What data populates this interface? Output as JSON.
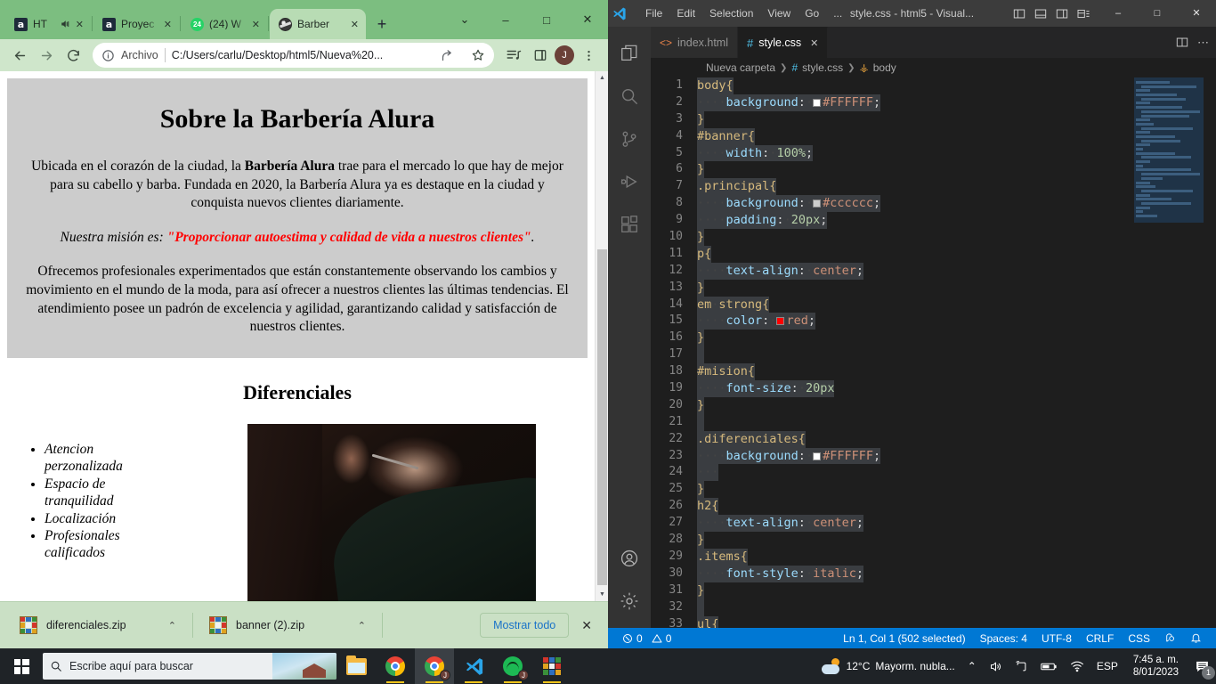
{
  "browser": {
    "tabs": [
      {
        "title": "HT",
        "favicon": "alura-icon",
        "muted": true,
        "active": false
      },
      {
        "title": "Proyec",
        "favicon": "alura-icon",
        "muted": false,
        "active": false
      },
      {
        "title": "(24) W",
        "favicon": "whatsapp-icon",
        "badge": "24",
        "muted": false,
        "active": false
      },
      {
        "title": "Barber",
        "favicon": "globe-icon",
        "muted": false,
        "active": true
      }
    ],
    "new_tab_label": "+",
    "window_controls": {
      "list": "⌄",
      "minimize": "–",
      "maximize": "□",
      "close": "✕"
    },
    "toolbar": {
      "back": "←",
      "forward": "→",
      "reload": "⟳",
      "site_info_icon": "info-icon",
      "omnibox_label": "Archivo",
      "omnibox_url": "C:/Users/carlu/Desktop/html5/Nueva%20...",
      "share_icon": "share-icon",
      "bookmark_icon": "star-icon",
      "reading_list_icon": "reading-list-icon",
      "side_panel_icon": "side-panel-icon",
      "profile_initial": "J",
      "menu_icon": "kebab-menu-icon"
    },
    "downloads": {
      "items": [
        {
          "name": "diferenciales.zip",
          "icon": "winrar-icon",
          "caret": "⌃"
        },
        {
          "name": "banner (2).zip",
          "icon": "winrar-icon",
          "caret": "⌃"
        }
      ],
      "show_all_label": "Mostrar todo",
      "close_label": "✕"
    }
  },
  "webpage": {
    "h1": "Sobre la Barbería Alura",
    "p1_part1": "Ubicada en el corazón de la ciudad, la ",
    "p1_strong": "Barbería Alura",
    "p1_part2": " trae para el mercado lo que hay de mejor para su cabello y barba. Fundada en 2020, la Barbería Alura ya es destaque en la ciudad y conquista nuevos clientes diariamente.",
    "mision_prefix": "Nuestra misión es: ",
    "mision_quote": "\"Proporcionar autoestima y calidad de vida a nuestros clientes\"",
    "mision_suffix": ".",
    "p3": "Ofrecemos profesionales experimentados que están constantemente observando los cambios y movimiento en el mundo de la moda, para así ofrecer a nuestros clientes las últimas tendencias. El atendimiento posee un padrón de excelencia y agilidad, garantizando calidad y satisfacción de nuestros clientes.",
    "h2": "Diferenciales",
    "items": [
      "Atencion perzonalizada",
      "Espacio de tranquilidad",
      "Localización",
      "Profesionales calificados"
    ],
    "image_alt": "barber-trimming-beard-photo"
  },
  "vscode": {
    "title": "style.css - html5 - Visual...",
    "menus": [
      "File",
      "Edit",
      "Selection",
      "View",
      "Go",
      "..."
    ],
    "layout_icons": [
      "toggle-primary-sidebar-icon",
      "toggle-panel-icon",
      "toggle-secondary-sidebar-icon",
      "customize-layout-icon"
    ],
    "window_controls": {
      "minimize": "–",
      "maximize": "□",
      "close": "✕"
    },
    "activity_bar": [
      "explorer-icon",
      "search-icon",
      "source-control-icon",
      "run-and-debug-icon",
      "extensions-icon",
      "account-icon",
      "settings-gear-icon"
    ],
    "tabs": [
      {
        "label": "index.html",
        "icon": "html-file-icon",
        "active": false
      },
      {
        "label": "style.css",
        "icon": "css-file-icon",
        "active": true,
        "close": "✕"
      }
    ],
    "editor_actions": [
      "split-editor-icon",
      "more-actions-icon"
    ],
    "breadcrumb": [
      "Nueva carpeta",
      "style.css",
      "body"
    ],
    "code_lines": [
      {
        "n": 1,
        "tokens": [
          {
            "t": "sel",
            "v": "body"
          },
          {
            "t": "brace",
            "v": "{"
          }
        ]
      },
      {
        "n": 2,
        "tokens": [
          {
            "t": "ws",
            "v": "····"
          },
          {
            "t": "prop",
            "v": "background"
          },
          {
            "t": "punc",
            "v": ":"
          },
          {
            "t": "ws",
            "v": "·"
          },
          {
            "t": "swatch",
            "v": "#FFFFFF"
          },
          {
            "t": "val",
            "v": "#FFFFFF"
          },
          {
            "t": "punc",
            "v": ";"
          }
        ]
      },
      {
        "n": 3,
        "tokens": [
          {
            "t": "brace",
            "v": "}"
          }
        ]
      },
      {
        "n": 4,
        "tokens": [
          {
            "t": "sel",
            "v": "#banner"
          },
          {
            "t": "brace",
            "v": "{"
          }
        ]
      },
      {
        "n": 5,
        "tokens": [
          {
            "t": "ws",
            "v": "····"
          },
          {
            "t": "prop",
            "v": "width"
          },
          {
            "t": "punc",
            "v": ":"
          },
          {
            "t": "ws",
            "v": "·"
          },
          {
            "t": "num",
            "v": "100%"
          },
          {
            "t": "punc",
            "v": ";"
          }
        ]
      },
      {
        "n": 6,
        "tokens": [
          {
            "t": "brace",
            "v": "}"
          }
        ]
      },
      {
        "n": 7,
        "tokens": [
          {
            "t": "sel",
            "v": ".principal"
          },
          {
            "t": "brace",
            "v": "{"
          }
        ]
      },
      {
        "n": 8,
        "tokens": [
          {
            "t": "ws",
            "v": "····"
          },
          {
            "t": "prop",
            "v": "background"
          },
          {
            "t": "punc",
            "v": ":"
          },
          {
            "t": "ws",
            "v": "·"
          },
          {
            "t": "swatch",
            "v": "#cccccc"
          },
          {
            "t": "val",
            "v": "#cccccc"
          },
          {
            "t": "punc",
            "v": ";"
          }
        ]
      },
      {
        "n": 9,
        "tokens": [
          {
            "t": "ws",
            "v": "····"
          },
          {
            "t": "prop",
            "v": "padding"
          },
          {
            "t": "punc",
            "v": ":"
          },
          {
            "t": "ws",
            "v": "·"
          },
          {
            "t": "num",
            "v": "20px"
          },
          {
            "t": "punc",
            "v": ";"
          }
        ]
      },
      {
        "n": 10,
        "tokens": [
          {
            "t": "brace",
            "v": "}"
          }
        ]
      },
      {
        "n": 11,
        "tokens": [
          {
            "t": "sel",
            "v": "p"
          },
          {
            "t": "brace",
            "v": "{"
          }
        ]
      },
      {
        "n": 12,
        "tokens": [
          {
            "t": "ws",
            "v": "····"
          },
          {
            "t": "prop",
            "v": "text-align"
          },
          {
            "t": "punc",
            "v": ":"
          },
          {
            "t": "ws",
            "v": "·"
          },
          {
            "t": "val",
            "v": "center"
          },
          {
            "t": "punc",
            "v": ";"
          }
        ]
      },
      {
        "n": 13,
        "tokens": [
          {
            "t": "brace",
            "v": "}"
          }
        ]
      },
      {
        "n": 14,
        "tokens": [
          {
            "t": "sel",
            "v": "em"
          },
          {
            "t": "ws",
            "v": "·"
          },
          {
            "t": "sel",
            "v": "strong"
          },
          {
            "t": "brace",
            "v": "{"
          }
        ]
      },
      {
        "n": 15,
        "tokens": [
          {
            "t": "ws",
            "v": "····"
          },
          {
            "t": "prop",
            "v": "color"
          },
          {
            "t": "punc",
            "v": ":"
          },
          {
            "t": "ws",
            "v": "·"
          },
          {
            "t": "swatch",
            "v": "#ff0000"
          },
          {
            "t": "val",
            "v": "red"
          },
          {
            "t": "punc",
            "v": ";"
          }
        ]
      },
      {
        "n": 16,
        "tokens": [
          {
            "t": "brace",
            "v": "}"
          }
        ]
      },
      {
        "n": 17,
        "tokens": []
      },
      {
        "n": 18,
        "tokens": [
          {
            "t": "sel",
            "v": "#mision"
          },
          {
            "t": "brace",
            "v": "{"
          }
        ]
      },
      {
        "n": 19,
        "tokens": [
          {
            "t": "ws",
            "v": "····"
          },
          {
            "t": "prop",
            "v": "font-size"
          },
          {
            "t": "punc",
            "v": ":"
          },
          {
            "t": "ws",
            "v": "·"
          },
          {
            "t": "num",
            "v": "20px"
          }
        ]
      },
      {
        "n": 20,
        "tokens": [
          {
            "t": "brace",
            "v": "}"
          }
        ]
      },
      {
        "n": 21,
        "tokens": []
      },
      {
        "n": 22,
        "tokens": [
          {
            "t": "sel",
            "v": ".diferenciales"
          },
          {
            "t": "brace",
            "v": "{"
          }
        ]
      },
      {
        "n": 23,
        "tokens": [
          {
            "t": "ws",
            "v": "····"
          },
          {
            "t": "prop",
            "v": "background"
          },
          {
            "t": "punc",
            "v": ":"
          },
          {
            "t": "ws",
            "v": "·"
          },
          {
            "t": "swatch",
            "v": "#FFFFFF"
          },
          {
            "t": "val",
            "v": "#FFFFFF"
          },
          {
            "t": "punc",
            "v": ";"
          }
        ]
      },
      {
        "n": 24,
        "tokens": [
          {
            "t": "ws",
            "v": "···"
          }
        ]
      },
      {
        "n": 25,
        "tokens": [
          {
            "t": "brace",
            "v": "}"
          }
        ]
      },
      {
        "n": 26,
        "tokens": [
          {
            "t": "sel",
            "v": "h2"
          },
          {
            "t": "brace",
            "v": "{"
          }
        ]
      },
      {
        "n": 27,
        "tokens": [
          {
            "t": "ws",
            "v": "····"
          },
          {
            "t": "prop",
            "v": "text-align"
          },
          {
            "t": "punc",
            "v": ":"
          },
          {
            "t": "ws",
            "v": "·"
          },
          {
            "t": "val",
            "v": "center"
          },
          {
            "t": "punc",
            "v": ";"
          }
        ]
      },
      {
        "n": 28,
        "tokens": [
          {
            "t": "brace",
            "v": "}"
          }
        ]
      },
      {
        "n": 29,
        "tokens": [
          {
            "t": "sel",
            "v": ".items"
          },
          {
            "t": "brace",
            "v": "{"
          }
        ]
      },
      {
        "n": 30,
        "tokens": [
          {
            "t": "ws",
            "v": "····"
          },
          {
            "t": "prop",
            "v": "font-style"
          },
          {
            "t": "punc",
            "v": ":"
          },
          {
            "t": "ws",
            "v": "·"
          },
          {
            "t": "val",
            "v": "italic"
          },
          {
            "t": "punc",
            "v": ";"
          }
        ]
      },
      {
        "n": 31,
        "tokens": [
          {
            "t": "brace",
            "v": "}"
          }
        ]
      },
      {
        "n": 32,
        "tokens": []
      },
      {
        "n": 33,
        "tokens": [
          {
            "t": "sel",
            "v": "ul"
          },
          {
            "t": "brace",
            "v": "{"
          }
        ]
      }
    ],
    "statusbar": {
      "errors_icon": "error-circle-icon",
      "errors": "0",
      "warnings_icon": "warning-triangle-icon",
      "warnings": "0",
      "cursor": "Ln 1, Col 1 (502 selected)",
      "indent": "Spaces: 4",
      "encoding": "UTF-8",
      "eol": "CRLF",
      "language": "CSS",
      "feedback_icon": "feedback-smiley-icon",
      "bell_icon": "bell-icon"
    }
  },
  "taskbar": {
    "start_label": "start-icon",
    "search_placeholder": "Escribe aquí para buscar",
    "apps": [
      {
        "name": "file-explorer",
        "icon": "explorer-icon"
      },
      {
        "name": "google-chrome",
        "icon": "chrome-icon"
      },
      {
        "name": "google-chrome-profile",
        "icon": "chrome-icon",
        "badge": "J",
        "active": true
      },
      {
        "name": "visual-studio-code",
        "icon": "vscode-icon"
      },
      {
        "name": "spotify",
        "icon": "spotify-icon",
        "badge": "J"
      },
      {
        "name": "winrar",
        "icon": "winrar-icon"
      }
    ],
    "tray": {
      "weather_temp": "12°C",
      "weather_desc": "Mayorm. nubla...",
      "chevron": "⌃",
      "volume_icon": "volume-icon",
      "screencast_icon": "screencast-icon",
      "battery_icon": "battery-icon",
      "wifi_icon": "wifi-icon",
      "language": "ESP",
      "time": "7:45 a. m.",
      "date": "8/01/2023",
      "notification_icon": "notification-icon",
      "notification_count": "1"
    }
  }
}
